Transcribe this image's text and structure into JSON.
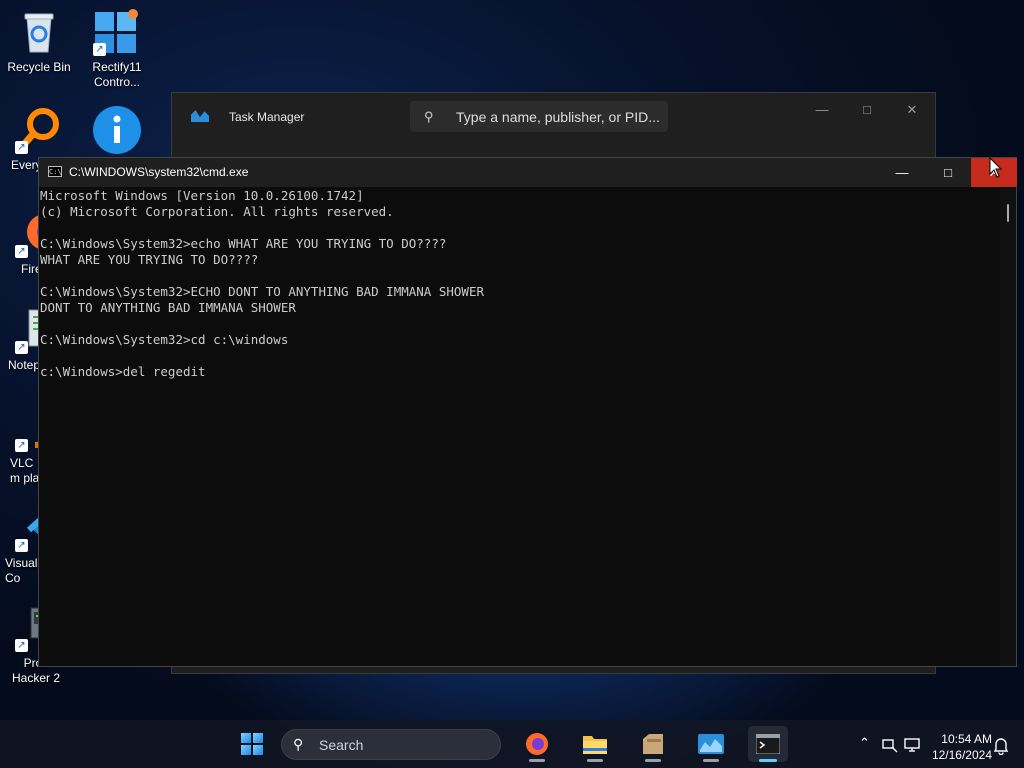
{
  "desktop": {
    "icons": [
      {
        "label": "Recycle Bin"
      },
      {
        "label": "Rectify11 Contro..."
      },
      {
        "label": "Every"
      },
      {
        "label": "Fire"
      },
      {
        "label": "Notep"
      },
      {
        "label": "VLC m pla"
      },
      {
        "label": "Visual Co"
      },
      {
        "label": "Proc Hacker 2"
      }
    ]
  },
  "task_manager": {
    "title": "Task Manager",
    "search_placeholder": "Type a name, publisher, or PID..."
  },
  "cmd": {
    "title": "C:\\WINDOWS\\system32\\cmd.exe",
    "lines": [
      "Microsoft Windows [Version 10.0.26100.1742]",
      "(c) Microsoft Corporation. All rights reserved.",
      "",
      "C:\\Windows\\System32>echo WHAT ARE YOU TRYING TO DO????",
      "WHAT ARE YOU TRYING TO DO????",
      "",
      "C:\\Windows\\System32>ECHO DONT TO ANYTHING BAD IMMANA SHOWER",
      "DONT TO ANYTHING BAD IMMANA SHOWER",
      "",
      "C:\\Windows\\System32>cd c:\\windows",
      "",
      "c:\\Windows>del regedit"
    ]
  },
  "taskbar": {
    "search_label": "Search",
    "apps": [
      "firefox",
      "file-explorer",
      "archive-app",
      "task-manager",
      "terminal"
    ],
    "active_app": "terminal",
    "clock": {
      "time": "10:54 AM",
      "date": "12/16/2024"
    }
  },
  "colors": {
    "close_hover": "#c42b1c",
    "terminal_text": "#cccccc",
    "accent": "#60cdff"
  }
}
